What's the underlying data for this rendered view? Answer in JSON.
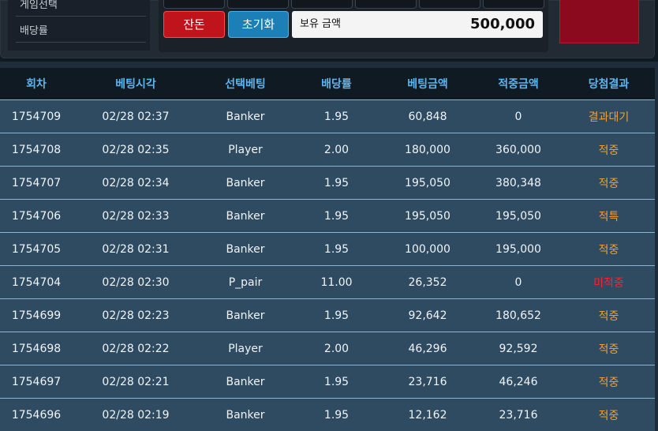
{
  "menu": {
    "items": [
      {
        "label": "게임선택"
      },
      {
        "label": "배당률"
      }
    ]
  },
  "controls": {
    "rest_label": "잔돈",
    "reset_label": "초기화",
    "balance_label": "보유 금액",
    "balance_value": "500,000"
  },
  "table": {
    "headers": [
      "회차",
      "베팅시각",
      "선택베팅",
      "배당률",
      "베팅금액",
      "적중금액",
      "당첨결과"
    ],
    "rows": [
      [
        "1754709",
        "02/28 02:37",
        "Banker",
        "1.95",
        "60,848",
        "0",
        "결과대기"
      ],
      [
        "1754708",
        "02/28 02:35",
        "Player",
        "2.00",
        "180,000",
        "360,000",
        "적중"
      ],
      [
        "1754707",
        "02/28 02:34",
        "Banker",
        "1.95",
        "195,050",
        "380,348",
        "적중"
      ],
      [
        "1754706",
        "02/28 02:33",
        "Banker",
        "1.95",
        "195,050",
        "195,050",
        "적특"
      ],
      [
        "1754705",
        "02/28 02:31",
        "Banker",
        "1.95",
        "100,000",
        "195,000",
        "적중"
      ],
      [
        "1754704",
        "02/28 02:30",
        "P_pair",
        "11.00",
        "26,352",
        "0",
        "미적중"
      ],
      [
        "1754699",
        "02/28 02:23",
        "Banker",
        "1.95",
        "92,642",
        "180,652",
        "적중"
      ],
      [
        "1754698",
        "02/28 02:22",
        "Player",
        "2.00",
        "46,296",
        "92,592",
        "적중"
      ],
      [
        "1754697",
        "02/28 02:21",
        "Banker",
        "1.95",
        "23,716",
        "46,246",
        "적중"
      ],
      [
        "1754696",
        "02/28 02:19",
        "Banker",
        "1.95",
        "12,162",
        "23,716",
        "적중"
      ]
    ]
  },
  "colors": {
    "header_text": "#5ab5f0",
    "row_bg": "#2f4b62",
    "result_win": "#f0a030",
    "result_lose": "#ff2030",
    "rest_button": "#c0141c",
    "reset_button": "#1c7fb5",
    "bet_button": "#8c0a1e"
  }
}
